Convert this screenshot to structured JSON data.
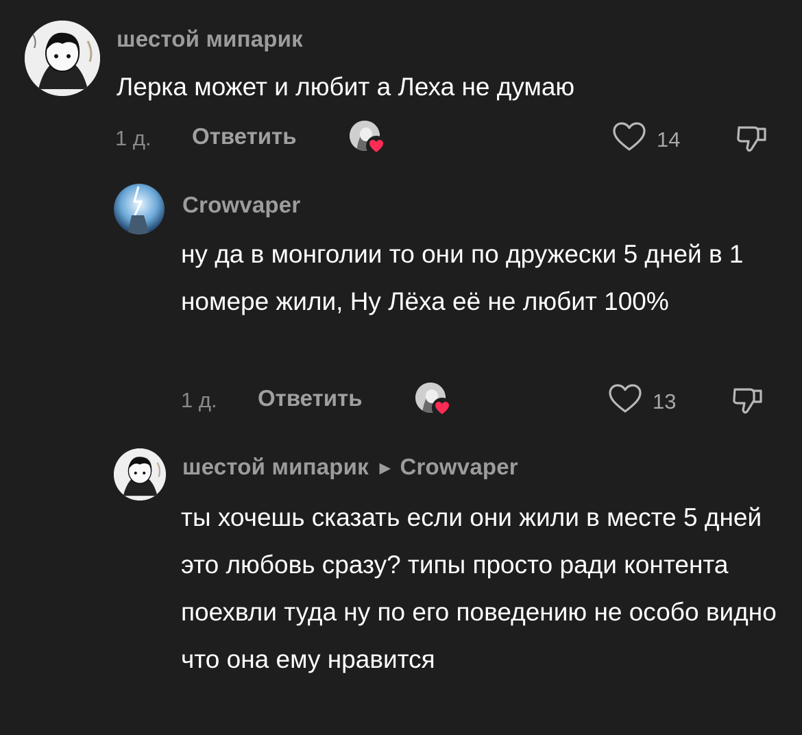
{
  "comments": [
    {
      "author": "шестой мипарик",
      "text": "Лерка может и любит а Леха не думаю",
      "time": "1 д.",
      "reply_label": "Ответить",
      "likes": "14",
      "avatar": "anime-avatar-icon"
    },
    {
      "author": "Crowvaper",
      "text": "ну да в монголии то они по дружески 5 дней в 1 номере жили, Ну Лёха её не любит 100%",
      "time": "1 д.",
      "reply_label": "Ответить",
      "likes": "13",
      "avatar": "lightning-avatar-icon"
    },
    {
      "author": "шестой мипарик",
      "reply_to": "Crowvaper",
      "text": "ты хочешь сказать если они жили в месте 5 дней это любовь сразу? типы просто ради контента поехвли туда ну по его поведению не особо видно что она ему нравится",
      "avatar": "anime-avatar-icon"
    }
  ],
  "colors": {
    "background": "#1e1e1e",
    "text": "#ffffff",
    "muted": "#9c9c9c",
    "heart_badge": "#fe2c55"
  }
}
